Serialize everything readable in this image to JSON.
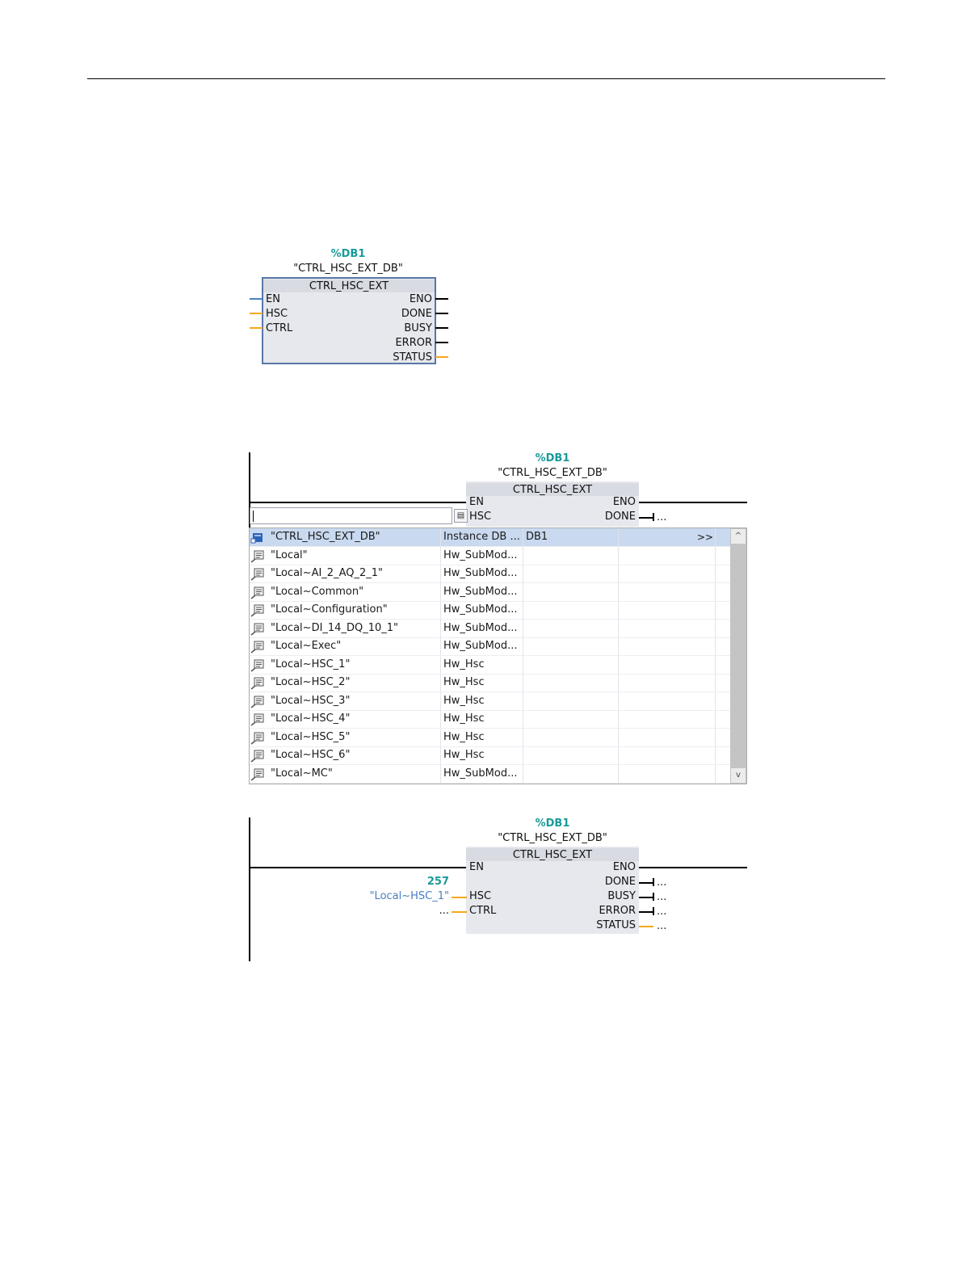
{
  "block": {
    "db_number": "%DB1",
    "db_name": "\"CTRL_HSC_EXT_DB\"",
    "type_name": "CTRL_HSC_EXT"
  },
  "pins": {
    "en": "EN",
    "hsc": "HSC",
    "ctrl": "CTRL",
    "eno": "ENO",
    "done": "DONE",
    "busy": "BUSY",
    "error": "ERROR",
    "status": "STATUS"
  },
  "dropdown": {
    "input_value": "",
    "expand_label": ">>",
    "scroll_up": "^",
    "scroll_down": "v",
    "rows": [
      {
        "name": "\"CTRL_HSC_EXT_DB\"",
        "type": "Instance DB ...",
        "addr": "DB1",
        "icon": "instance-db-icon"
      },
      {
        "name": "\"Local\"",
        "type": "Hw_SubMod...",
        "addr": "",
        "icon": "hw-tag-icon"
      },
      {
        "name": "\"Local~AI_2_AQ_2_1\"",
        "type": "Hw_SubMod...",
        "addr": "",
        "icon": "hw-tag-icon"
      },
      {
        "name": "\"Local~Common\"",
        "type": "Hw_SubMod...",
        "addr": "",
        "icon": "hw-tag-icon"
      },
      {
        "name": "\"Local~Configuration\"",
        "type": "Hw_SubMod...",
        "addr": "",
        "icon": "hw-tag-icon"
      },
      {
        "name": "\"Local~DI_14_DQ_10_1\"",
        "type": "Hw_SubMod...",
        "addr": "",
        "icon": "hw-tag-icon"
      },
      {
        "name": "\"Local~Exec\"",
        "type": "Hw_SubMod...",
        "addr": "",
        "icon": "hw-tag-icon"
      },
      {
        "name": "\"Local~HSC_1\"",
        "type": "Hw_Hsc",
        "addr": "",
        "icon": "hw-tag-icon"
      },
      {
        "name": "\"Local~HSC_2\"",
        "type": "Hw_Hsc",
        "addr": "",
        "icon": "hw-tag-icon"
      },
      {
        "name": "\"Local~HSC_3\"",
        "type": "Hw_Hsc",
        "addr": "",
        "icon": "hw-tag-icon"
      },
      {
        "name": "\"Local~HSC_4\"",
        "type": "Hw_Hsc",
        "addr": "",
        "icon": "hw-tag-icon"
      },
      {
        "name": "\"Local~HSC_5\"",
        "type": "Hw_Hsc",
        "addr": "",
        "icon": "hw-tag-icon"
      },
      {
        "name": "\"Local~HSC_6\"",
        "type": "Hw_Hsc",
        "addr": "",
        "icon": "hw-tag-icon"
      },
      {
        "name": "\"Local~MC\"",
        "type": "Hw_SubMod...",
        "addr": "",
        "icon": "hw-tag-icon"
      }
    ]
  },
  "section2": {
    "done_dots": "..."
  },
  "section3": {
    "hsc_value": "257",
    "hsc_tag": "\"Local~HSC_1\"",
    "ctrl_param": "...",
    "done_param": "...",
    "busy_param": "...",
    "error_param": "...",
    "status_param": "..."
  },
  "colors": {
    "db_number": "#1a9a9a",
    "tag_blue": "#4a7fc1",
    "wire_orange": "#f4a81d",
    "block_fill": "#e6e8ed",
    "selection": "#c9d9ef"
  }
}
